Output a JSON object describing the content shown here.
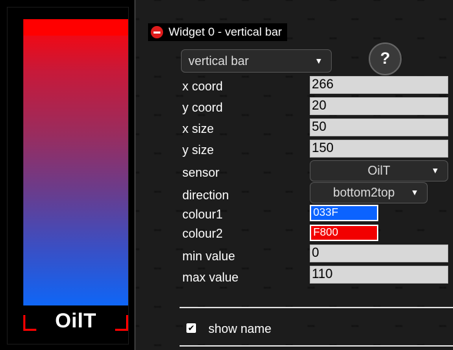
{
  "preview": {
    "sensor_name": "OilT",
    "colour1": "#0f66f6",
    "colour2": "#ee0a17"
  },
  "widget": {
    "title": "Widget 0 - vertical bar",
    "type_select": "vertical bar",
    "help_label": "?"
  },
  "fields": {
    "x_coord": {
      "label": "x coord",
      "value": "266"
    },
    "y_coord": {
      "label": "y coord",
      "value": "20"
    },
    "x_size": {
      "label": "x size",
      "value": "50"
    },
    "y_size": {
      "label": "y size",
      "value": "150"
    },
    "sensor": {
      "label": "sensor",
      "value": "OilT"
    },
    "direction": {
      "label": "direction",
      "value": "bottom2top"
    },
    "colour1": {
      "label": "colour1",
      "value": "033F",
      "color": "#0b63ff"
    },
    "colour2": {
      "label": "colour2",
      "value": "F800",
      "color": "#f20000"
    },
    "min_value": {
      "label": "min value",
      "value": "0"
    },
    "max_value": {
      "label": "max value",
      "value": "110"
    }
  },
  "options": {
    "show_name_label": "show name",
    "show_name_checked": true
  }
}
